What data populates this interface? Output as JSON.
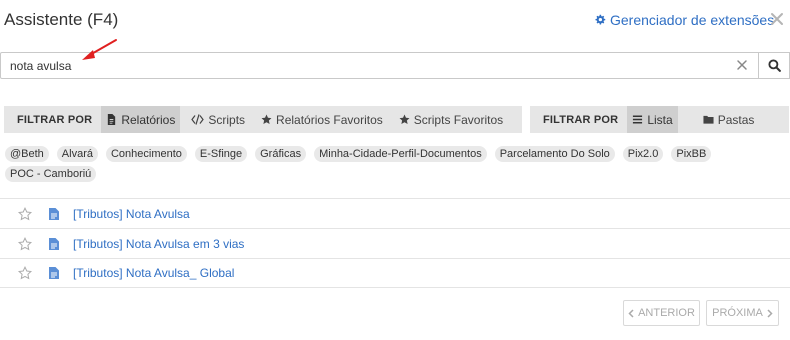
{
  "header": {
    "title": "Assistente (F4)",
    "extensions_link": "Gerenciador de extensões"
  },
  "search": {
    "value": "nota avulsa"
  },
  "filter_left": {
    "label": "FILTRAR POR",
    "options": [
      {
        "label": "Relatórios",
        "icon": "file-icon",
        "active": true
      },
      {
        "label": "Scripts",
        "icon": "code-icon",
        "active": false
      },
      {
        "label": "Relatórios Favoritos",
        "icon": "star-icon",
        "active": false
      },
      {
        "label": "Scripts Favoritos",
        "icon": "star-icon",
        "active": false
      }
    ]
  },
  "filter_right": {
    "label": "FILTRAR POR",
    "options": [
      {
        "label": "Lista",
        "icon": "list-icon",
        "active": true
      },
      {
        "label": "Pastas",
        "icon": "folder-icon",
        "active": false
      }
    ]
  },
  "tags": [
    "@Beth",
    "Alvará",
    "Conhecimento",
    "E-Sfinge",
    "Gráficas",
    "Minha-Cidade-Perfil-Documentos",
    "Parcelamento Do Solo",
    "Pix2.0",
    "PixBB",
    "POC - Camboriú"
  ],
  "results": [
    {
      "title": "[Tributos] Nota Avulsa"
    },
    {
      "title": "[Tributos] Nota Avulsa em 3 vias"
    },
    {
      "title": "[Tributos] Nota Avulsa_ Global"
    }
  ],
  "pagination": {
    "prev_label": "ANTERIOR",
    "next_label": "PRÓXIMA"
  },
  "colors": {
    "link": "#2f6fc4",
    "filter_bg": "#e6e6e6",
    "filter_active": "#cfcfcf",
    "tag_bg": "#e9e9e9",
    "arrow": "#e02020"
  }
}
